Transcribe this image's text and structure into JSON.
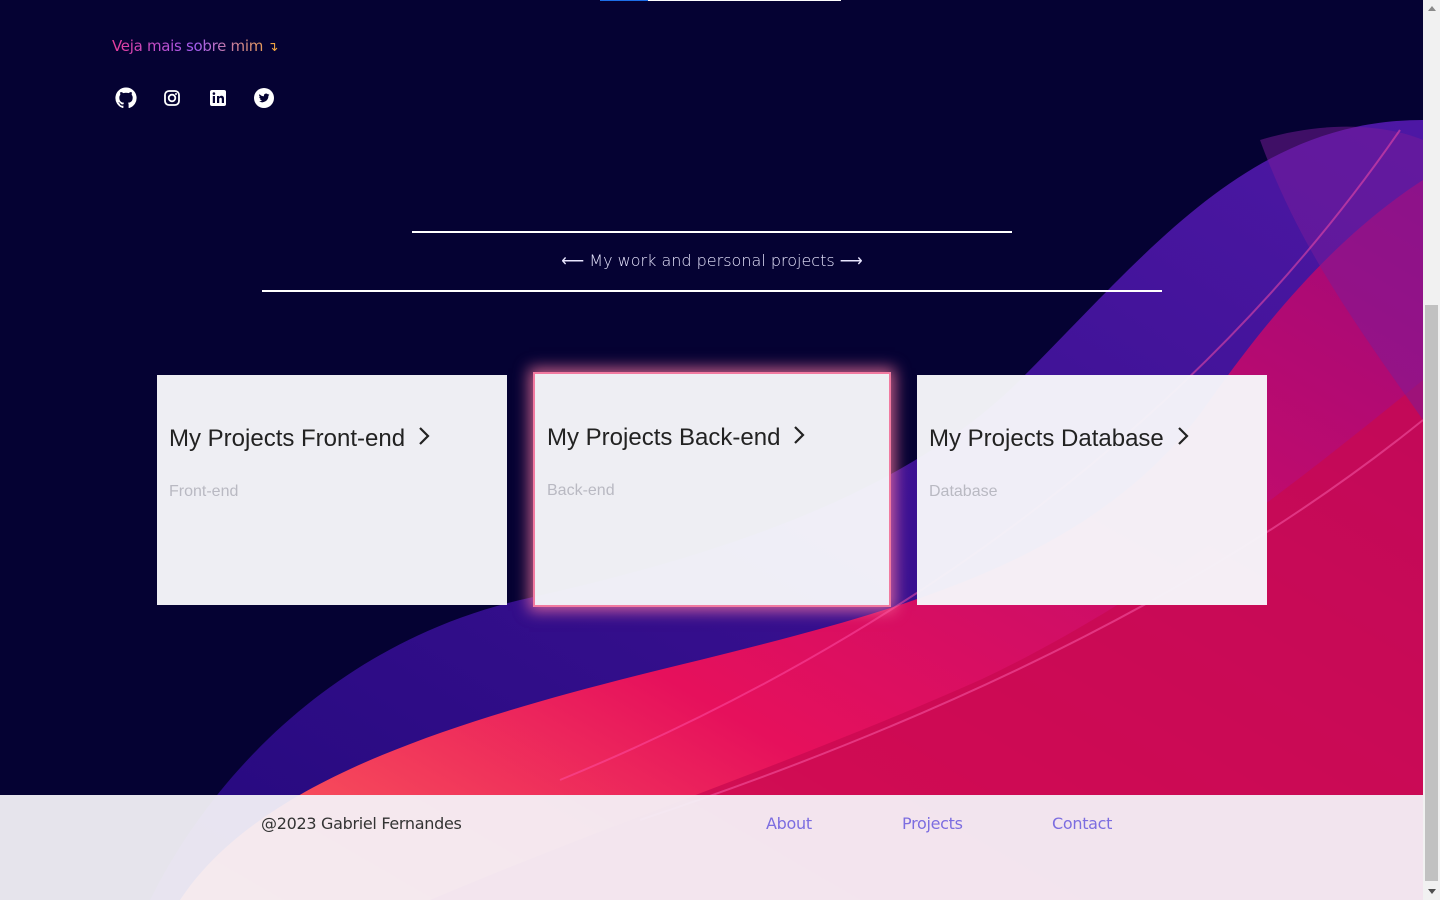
{
  "intro": {
    "see_more": "Veja mais sobre mim",
    "see_more_arrow": "↴"
  },
  "socials": [
    "github-icon",
    "instagram-icon",
    "linkedin-icon",
    "twitter-icon"
  ],
  "section": {
    "label": "⟵ My work and personal projects ⟶"
  },
  "cards": [
    {
      "title": "My Projects Front-end",
      "subtitle": "Front-end"
    },
    {
      "title": "My Projects Back-end",
      "subtitle": "Back-end"
    },
    {
      "title": "My Projects Database",
      "subtitle": "Database"
    }
  ],
  "footer": {
    "copyright": "@2023 Gabriel Fernandes",
    "nav": [
      "About",
      "Projects",
      "Contact"
    ]
  },
  "colors": {
    "background": "#050233",
    "accent_link": "#7c6de0",
    "wave_pink": "#e8115f",
    "wave_purple": "#3b0aa8"
  }
}
